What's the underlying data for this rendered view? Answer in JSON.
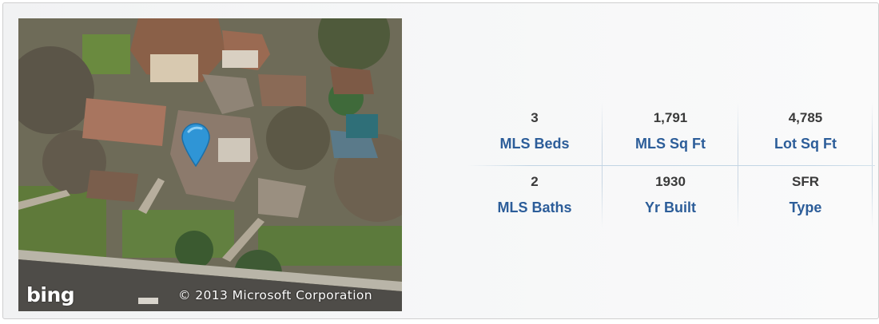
{
  "map": {
    "logo_text": "bing",
    "copyright": "© 2013 Microsoft Corporation",
    "pin_color": "#2f95d6"
  },
  "stats": {
    "row1": [
      {
        "value": "3",
        "label": "MLS Beds"
      },
      {
        "value": "1,791",
        "label": "MLS Sq Ft"
      },
      {
        "value": "4,785",
        "label": "Lot Sq Ft"
      }
    ],
    "row2": [
      {
        "value": "2",
        "label": "MLS Baths"
      },
      {
        "value": "1930",
        "label": "Yr Built"
      },
      {
        "value": "SFR",
        "label": "Type"
      }
    ]
  },
  "colors": {
    "label_blue": "#2c5d99",
    "value_gray": "#3a3a3a"
  }
}
